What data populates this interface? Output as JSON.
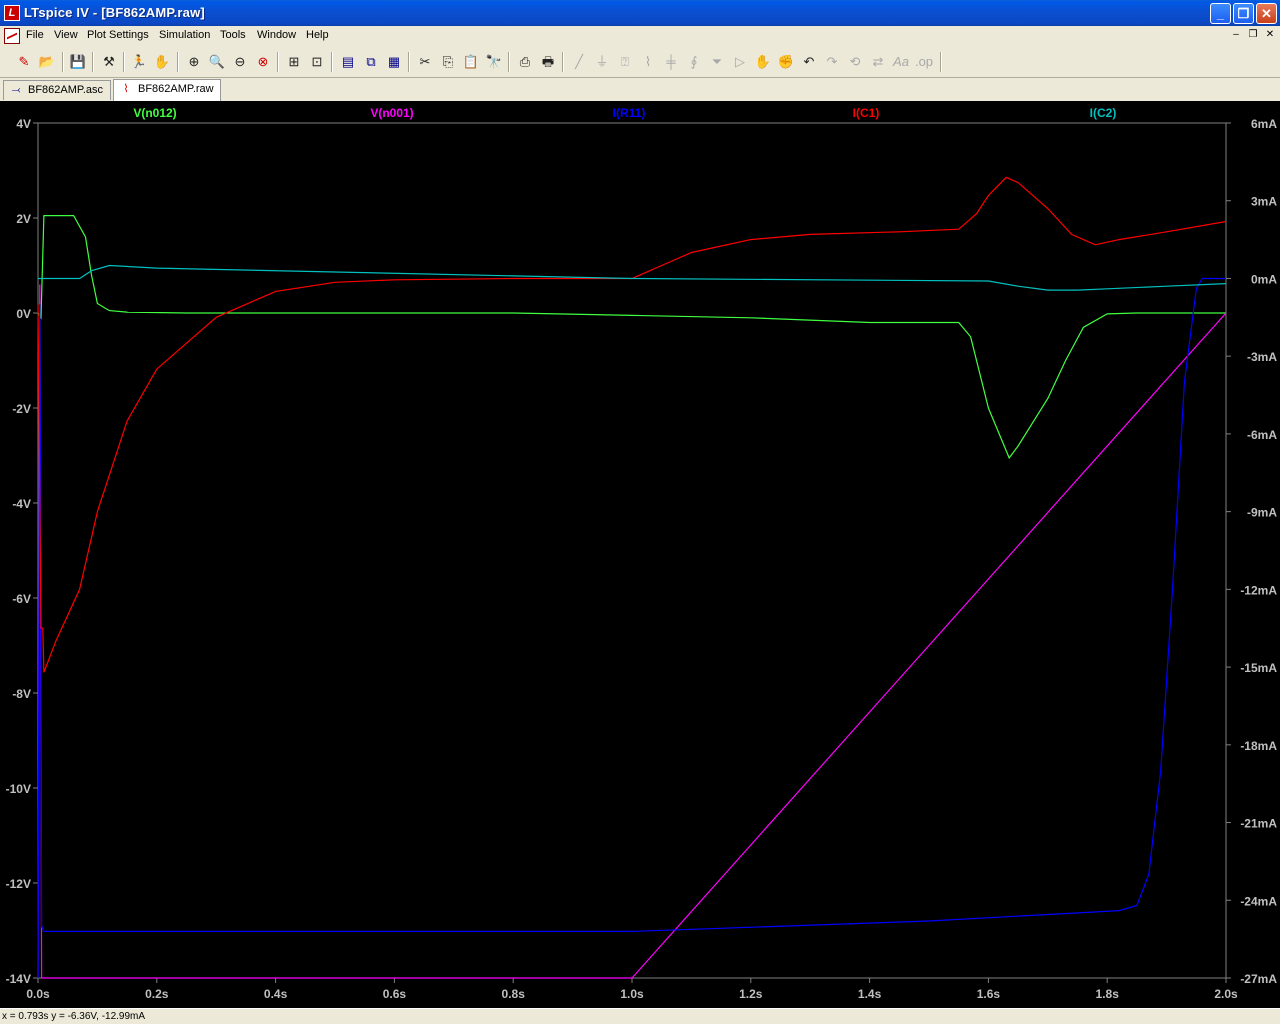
{
  "window": {
    "title": "LTspice IV - [BF862AMP.raw]",
    "app_icon": "ltspice-logo-icon",
    "controls": [
      "minimize-icon",
      "maximize-icon",
      "close-icon"
    ]
  },
  "menu": {
    "items": [
      "File",
      "View",
      "Plot Settings",
      "Simulation",
      "Tools",
      "Window",
      "Help"
    ],
    "mdi_controls": [
      "–",
      "❐",
      "✕"
    ]
  },
  "toolbar": {
    "icons": [
      "new-schematic-icon",
      "open-icon",
      "save-icon",
      "control-panel-icon",
      "run-icon",
      "halt-icon",
      "zoom-in-icon",
      "zoom-out-icon",
      "zoom-full-icon",
      "cancel-zoom-icon",
      "autorange-icon",
      "mark-icon",
      "tile-vertical-icon",
      "cascade-icon",
      "tile-horizontal-icon",
      "cut-icon",
      "copy-icon",
      "paste-icon",
      "find-icon",
      "print-setup-icon",
      "print-icon",
      "wire-icon",
      "ground-icon",
      "label-icon",
      "resistor-icon",
      "capacitor-icon",
      "inductor-icon",
      "diode-icon",
      "component-icon",
      "move-icon",
      "drag-icon",
      "undo-icon",
      "redo-icon",
      "rotate-icon",
      "mirror-icon",
      "text-icon",
      "spice-directive-icon"
    ]
  },
  "tabs": [
    {
      "label": "BF862AMP.asc",
      "icon": "schematic-icon"
    },
    {
      "label": "BF862AMP.raw",
      "icon": "waveform-icon"
    }
  ],
  "statusbar": {
    "text": "x = 0.793s    y = -6.36V, -12.99mA"
  },
  "colors": {
    "plot_bg": "#000000",
    "axis": "#808080",
    "v_n012": "#40ff40",
    "v_n001": "#ff00ff",
    "i_r11": "#0000ff",
    "i_c1": "#ff0000",
    "i_c2": "#00c0c0"
  },
  "chart_data": {
    "type": "line",
    "xlabel_ticks": [
      "0.0s",
      "0.2s",
      "0.4s",
      "0.6s",
      "0.8s",
      "1.0s",
      "1.2s",
      "1.4s",
      "1.6s",
      "1.8s",
      "2.0s"
    ],
    "xlim": [
      0,
      2.0
    ],
    "ylim_left": [
      -14,
      4
    ],
    "ylim_right": [
      -27,
      6
    ],
    "yticks_left": [
      "4V",
      "2V",
      "0V",
      "-2V",
      "-4V",
      "-6V",
      "-8V",
      "-10V",
      "-12V",
      "-14V"
    ],
    "yticks_right": [
      "6mA",
      "3mA",
      "0mA",
      "-3mA",
      "-6mA",
      "-9mA",
      "-12mA",
      "-15mA",
      "-18mA",
      "-21mA",
      "-24mA",
      "-27mA"
    ],
    "grid": false,
    "series": [
      {
        "name": "V(n012)",
        "axis": "left",
        "color": "#40ff40",
        "x": [
          0,
          0.005,
          0.01,
          0.06,
          0.08,
          0.09,
          0.1,
          0.12,
          0.15,
          0.25,
          0.5,
          0.8,
          1.0,
          1.2,
          1.4,
          1.55,
          1.57,
          1.6,
          1.635,
          1.65,
          1.7,
          1.73,
          1.76,
          1.8,
          1.85,
          1.9,
          2.0
        ],
        "y": [
          0,
          -0.1,
          2.05,
          2.05,
          1.6,
          0.8,
          0.2,
          0.05,
          0.02,
          0.0,
          0.0,
          0.0,
          -0.05,
          -0.1,
          -0.2,
          -0.2,
          -0.5,
          -2.0,
          -3.05,
          -2.8,
          -1.8,
          -1.0,
          -0.3,
          -0.02,
          0.0,
          0.0,
          0.0
        ]
      },
      {
        "name": "V(n001)",
        "axis": "left",
        "color": "#ff00ff",
        "x": [
          0,
          0.003,
          0.006,
          0.01,
          0.5,
          1.0,
          1.5,
          2.0
        ],
        "y": [
          -14,
          0.6,
          -14,
          -14,
          -14,
          -14,
          -7,
          0.0
        ]
      },
      {
        "name": "I(R11)",
        "axis": "right",
        "color": "#0000ff",
        "x": [
          0,
          0.003,
          0.006,
          0.01,
          0.5,
          1.0,
          1.5,
          1.82,
          1.85,
          1.87,
          1.89,
          1.91,
          1.93,
          1.95,
          1.96,
          1.97,
          1.99,
          2.0
        ],
        "y": [
          -27,
          -1,
          -25,
          -25.2,
          -25.2,
          -25.2,
          -24.8,
          -24.4,
          -24.2,
          -23,
          -19,
          -12,
          -4,
          -0.4,
          0.0,
          0.0,
          0.0,
          0.0
        ]
      },
      {
        "name": "I(C1)",
        "axis": "right",
        "color": "#ff0000",
        "x": [
          0,
          0.005,
          0.008,
          0.01,
          0.03,
          0.07,
          0.1,
          0.15,
          0.2,
          0.3,
          0.4,
          0.5,
          0.6,
          0.8,
          1.0,
          1.05,
          1.1,
          1.2,
          1.3,
          1.45,
          1.55,
          1.58,
          1.6,
          1.63,
          1.65,
          1.7,
          1.74,
          1.78,
          1.82,
          1.9,
          2.0
        ],
        "y": [
          -1,
          -13.5,
          -13.5,
          -15.2,
          -14,
          -12,
          -9,
          -5.5,
          -3.5,
          -1.5,
          -0.5,
          -0.15,
          -0.05,
          0.0,
          0.0,
          0.5,
          1.0,
          1.5,
          1.7,
          1.8,
          1.9,
          2.5,
          3.2,
          3.9,
          3.7,
          2.7,
          1.7,
          1.3,
          1.5,
          1.8,
          2.2
        ]
      },
      {
        "name": "I(C2)",
        "axis": "right",
        "color": "#00c0c0",
        "x": [
          0,
          0.07,
          0.09,
          0.12,
          0.2,
          0.5,
          1.0,
          1.6,
          1.65,
          1.7,
          1.75,
          1.8,
          1.9,
          2.0
        ],
        "y": [
          0,
          0,
          0.3,
          0.5,
          0.4,
          0.25,
          0.0,
          -0.1,
          -0.3,
          -0.45,
          -0.45,
          -0.4,
          -0.3,
          -0.2
        ]
      }
    ]
  }
}
